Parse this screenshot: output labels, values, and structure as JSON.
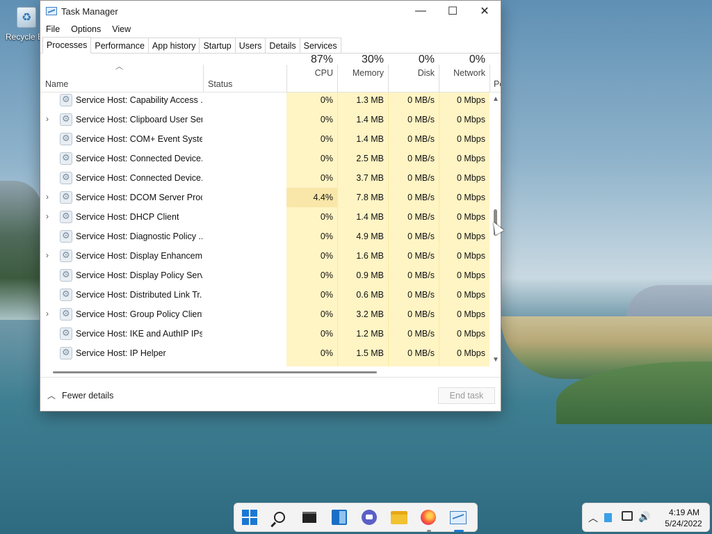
{
  "desktop": {
    "recycle_bin_label": "Recycle Bin"
  },
  "window": {
    "title": "Task Manager",
    "controls": {
      "minimize": "—",
      "maximize": "☐",
      "close": "✕"
    },
    "menu": [
      "File",
      "Options",
      "View"
    ],
    "tabs": [
      "Processes",
      "Performance",
      "App history",
      "Startup",
      "Users",
      "Details",
      "Services"
    ],
    "active_tab": "Processes"
  },
  "table": {
    "headers": {
      "name": "Name",
      "status": "Status",
      "cpu": {
        "pct": "87%",
        "label": "CPU"
      },
      "memory": {
        "pct": "30%",
        "label": "Memory"
      },
      "disk": {
        "pct": "0%",
        "label": "Disk"
      },
      "network": {
        "pct": "0%",
        "label": "Network"
      },
      "power": "Po"
    },
    "rows": [
      {
        "expand": "",
        "name": "Service Host: Capability Access ...",
        "cpu": "0%",
        "memory": "1.3 MB",
        "disk": "0 MB/s",
        "network": "0 Mbps"
      },
      {
        "expand": "›",
        "name": "Service Host: Clipboard User Ser...",
        "cpu": "0%",
        "memory": "1.4 MB",
        "disk": "0 MB/s",
        "network": "0 Mbps"
      },
      {
        "expand": "",
        "name": "Service Host: COM+ Event Syste...",
        "cpu": "0%",
        "memory": "1.4 MB",
        "disk": "0 MB/s",
        "network": "0 Mbps"
      },
      {
        "expand": "",
        "name": "Service Host: Connected Device...",
        "cpu": "0%",
        "memory": "2.5 MB",
        "disk": "0 MB/s",
        "network": "0 Mbps"
      },
      {
        "expand": "",
        "name": "Service Host: Connected Device...",
        "cpu": "0%",
        "memory": "3.7 MB",
        "disk": "0 MB/s",
        "network": "0 Mbps"
      },
      {
        "expand": "›",
        "name": "Service Host: DCOM Server Proc...",
        "cpu": "4.4%",
        "memory": "7.8 MB",
        "disk": "0 MB/s",
        "network": "0 Mbps",
        "highlight": true
      },
      {
        "expand": "›",
        "name": "Service Host: DHCP Client",
        "cpu": "0%",
        "memory": "1.4 MB",
        "disk": "0 MB/s",
        "network": "0 Mbps"
      },
      {
        "expand": "",
        "name": "Service Host: Diagnostic Policy ...",
        "cpu": "0%",
        "memory": "4.9 MB",
        "disk": "0 MB/s",
        "network": "0 Mbps"
      },
      {
        "expand": "›",
        "name": "Service Host: Display Enhancem...",
        "cpu": "0%",
        "memory": "1.6 MB",
        "disk": "0 MB/s",
        "network": "0 Mbps"
      },
      {
        "expand": "",
        "name": "Service Host: Display Policy Serv...",
        "cpu": "0%",
        "memory": "0.9 MB",
        "disk": "0 MB/s",
        "network": "0 Mbps"
      },
      {
        "expand": "",
        "name": "Service Host: Distributed Link Tr...",
        "cpu": "0%",
        "memory": "0.6 MB",
        "disk": "0 MB/s",
        "network": "0 Mbps"
      },
      {
        "expand": "›",
        "name": "Service Host: Group Policy Client",
        "cpu": "0%",
        "memory": "3.2 MB",
        "disk": "0 MB/s",
        "network": "0 Mbps"
      },
      {
        "expand": "",
        "name": "Service Host: IKE and AuthIP IPs...",
        "cpu": "0%",
        "memory": "1.2 MB",
        "disk": "0 MB/s",
        "network": "0 Mbps"
      },
      {
        "expand": "",
        "name": "Service Host: IP Helper",
        "cpu": "0%",
        "memory": "1.5 MB",
        "disk": "0 MB/s",
        "network": "0 Mbps"
      }
    ]
  },
  "footer": {
    "fewer_details": "Fewer details",
    "end_task": "End task"
  },
  "colors": {
    "cpu_bg": "#fff4c4",
    "mem_bg": "#fff4c4",
    "cpu_high": "#f8e7a8",
    "accent": "#1a78d4"
  },
  "taskbar": {
    "icons": [
      "start-icon",
      "search-icon",
      "task-view-icon",
      "widgets-icon",
      "chat-icon",
      "file-explorer-icon",
      "firefox-icon",
      "task-manager-icon"
    ]
  },
  "tray": {
    "time": "4:19 AM",
    "date": "5/24/2022"
  }
}
